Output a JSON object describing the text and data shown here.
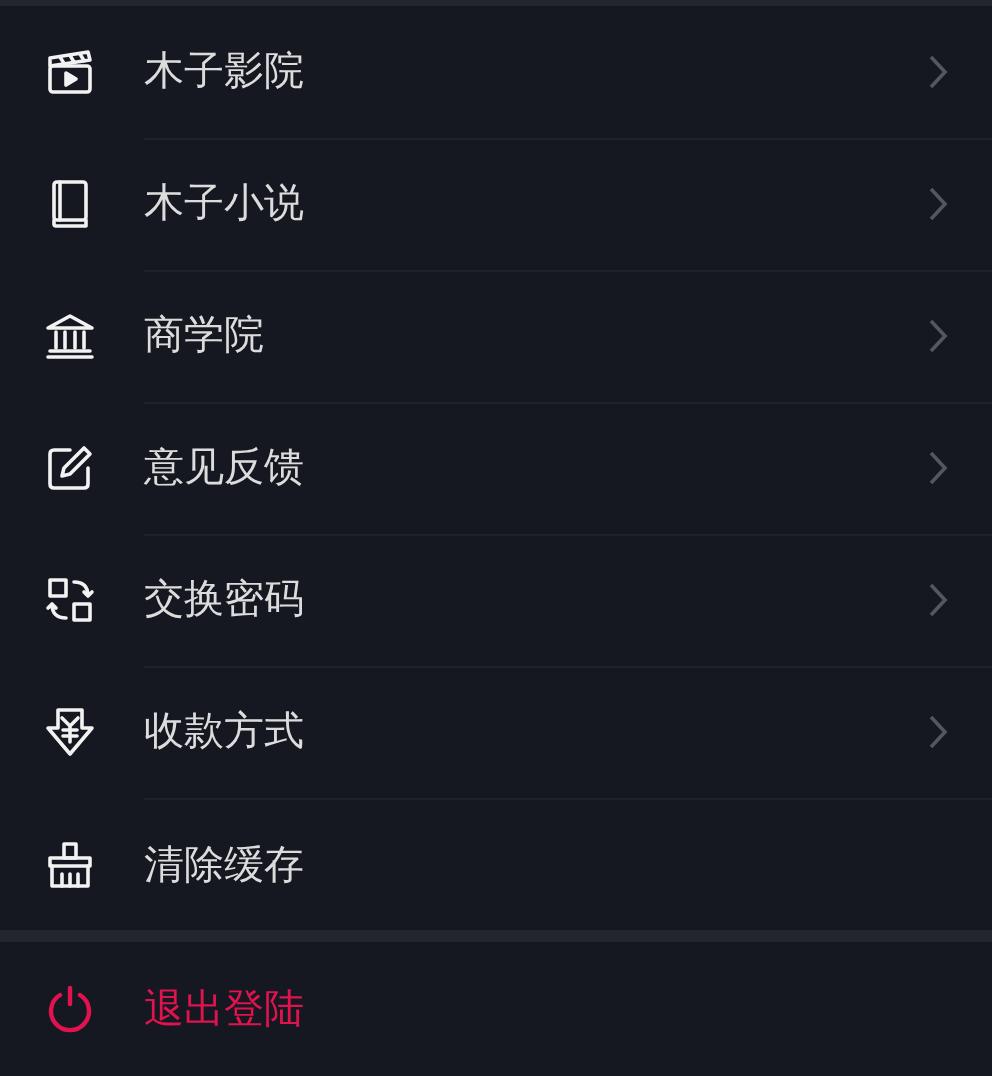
{
  "menu": [
    {
      "label": "木子影院",
      "chevron": true
    },
    {
      "label": "木子小说",
      "chevron": true
    },
    {
      "label": "商学院",
      "chevron": true
    },
    {
      "label": "意见反馈",
      "chevron": true
    },
    {
      "label": "交换密码",
      "chevron": true
    },
    {
      "label": "收款方式",
      "chevron": true
    },
    {
      "label": "清除缓存",
      "chevron": false
    }
  ],
  "logout": {
    "label": "退出登陆"
  }
}
